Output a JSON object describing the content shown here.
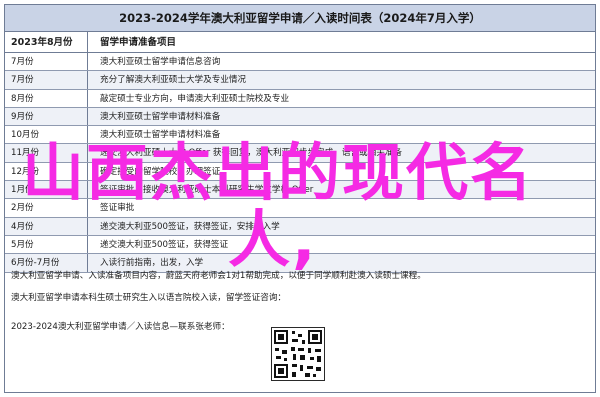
{
  "title": "2023-2024学年澳大利亚留学申请／入读时间表（2024年7月入学）",
  "header": {
    "left": "2023年8月份",
    "right": "留学申请准备项目"
  },
  "rows": [
    {
      "month": "7月份",
      "task": "澳大利亚硕士留学申请信息咨询"
    },
    {
      "month": "7月份",
      "task": "充分了解澳大利亚硕士大学及专业情况"
    },
    {
      "month": "8月份",
      "task": "敲定硕士专业方向，申请澳大利亚硕士院校及专业"
    },
    {
      "month": "9月份",
      "task": "澳大利亚硕士留学申请材料准备"
    },
    {
      "month": "10月份",
      "task": "澳大利亚硕士留学申请材料准备"
    },
    {
      "month": "11月份",
      "task": "递交澳大利亚硕士大学 Offer 获得回复，澳大利亚初步步完成，语言或相关准备"
    },
    {
      "month": "12月份",
      "task": "确定接受的留学院校，办理签证"
    },
    {
      "month": "1月份",
      "task": "签证审批，接收澳大利亚硕士本科研究生学位学校 Offer"
    },
    {
      "month": "2月份",
      "task": "签证审批"
    },
    {
      "month": "4月份",
      "task": "递交澳大利亚500签证，获得签证，安排好入学"
    },
    {
      "month": "5月份",
      "task": "递交澳大利亚500签证，获得签证"
    },
    {
      "month": "6月份-7月份",
      "task": "入读行前指南，出发，入学"
    }
  ],
  "footer": {
    "line1": "澳大利亚留学申请、入读准备项目内容，蔚蓝天府老师会1对1帮助完成，以便于同学顺利赴澳入读硕士课程。",
    "line2": "澳大利亚留学申请本科生硕士研究生入以语言院校入读，留学签证咨询：",
    "line3": "2023-2024澳大利亚留学申请／入读信息—联系张老师："
  },
  "overlay": {
    "line1": "山西杰出的现代名",
    "line2": "人,"
  }
}
